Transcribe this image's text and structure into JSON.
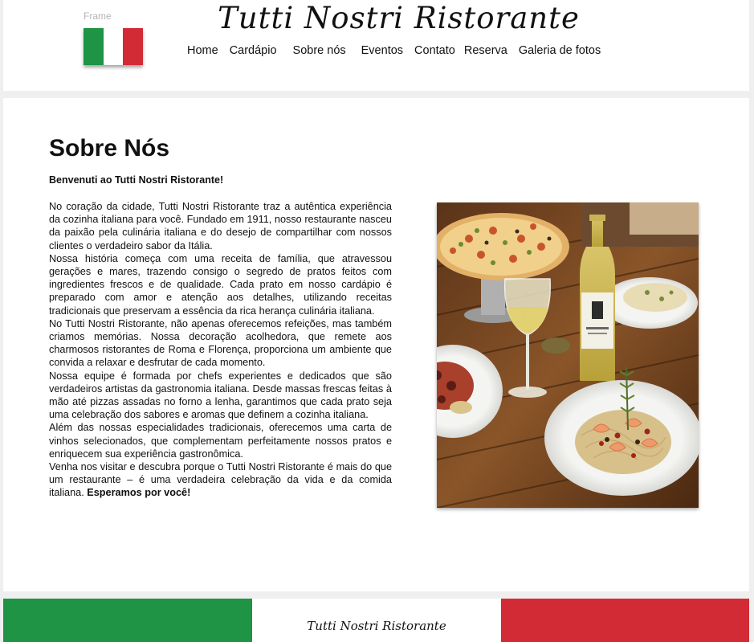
{
  "header": {
    "frame_label": "Frame",
    "brand": "Tutti Nostri Ristorante",
    "flag_colors": [
      "#1e9444",
      "#ffffff",
      "#d22b36"
    ],
    "nav": [
      "Home",
      "Cardápio",
      "Sobre nós",
      "Eventos",
      "Contato",
      "Reserva",
      "Galeria de fotos"
    ]
  },
  "main": {
    "title": "Sobre Nós",
    "welcome": "Benvenuti ao Tutti Nostri Ristorante!",
    "paragraphs": [
      "No coração da cidade, Tutti Nostri Ristorante traz a autêntica experiência da cozinha italiana para você. Fundado em 1911, nosso restaurante nasceu da paixão pela culinária italiana e do desejo de compartilhar com nossos clientes o verdadeiro sabor da Itália.",
      "Nossa história começa com uma receita de família, que atravessou gerações e mares, trazendo consigo o segredo de pratos feitos com ingredientes frescos e de qualidade. Cada prato em nosso cardápio é preparado com amor e atenção aos detalhes, utilizando receitas tradicionais que preservam a essência da rica herança culinária italiana.",
      "No Tutti Nostri Ristorante, não apenas oferecemos refeições, mas também criamos memórias. Nossa decoração acolhedora, que remete aos charmosos ristorantes de Roma e Florença, proporciona um ambiente que convida a relaxar e desfrutar de cada momento.",
      "Nossa equipe é formada por chefs experientes e dedicados que são verdadeiros artistas da gastronomia italiana. Desde massas frescas feitas à mão até pizzas assadas no forno a lenha, garantimos que cada prato seja uma celebração dos sabores e aromas que definem a cozinha italiana.",
      "Além das nossas especialidades tradicionais, oferecemos uma carta de vinhos selecionados, que complementam perfeitamente nossos pratos e enriquecem sua experiência gastronômica."
    ],
    "closing": "Venha nos visitar e descubra porque o Tutti Nostri Ristorante é mais do que um restaurante – é uma verdadeira celebração da vida e da comida italiana.",
    "closing_bold": "Esperamos por você!"
  },
  "footer": {
    "brand": "Tutti Nostri Ristorante",
    "colors": [
      "#1e9444",
      "#ffffff",
      "#d22b36"
    ]
  }
}
